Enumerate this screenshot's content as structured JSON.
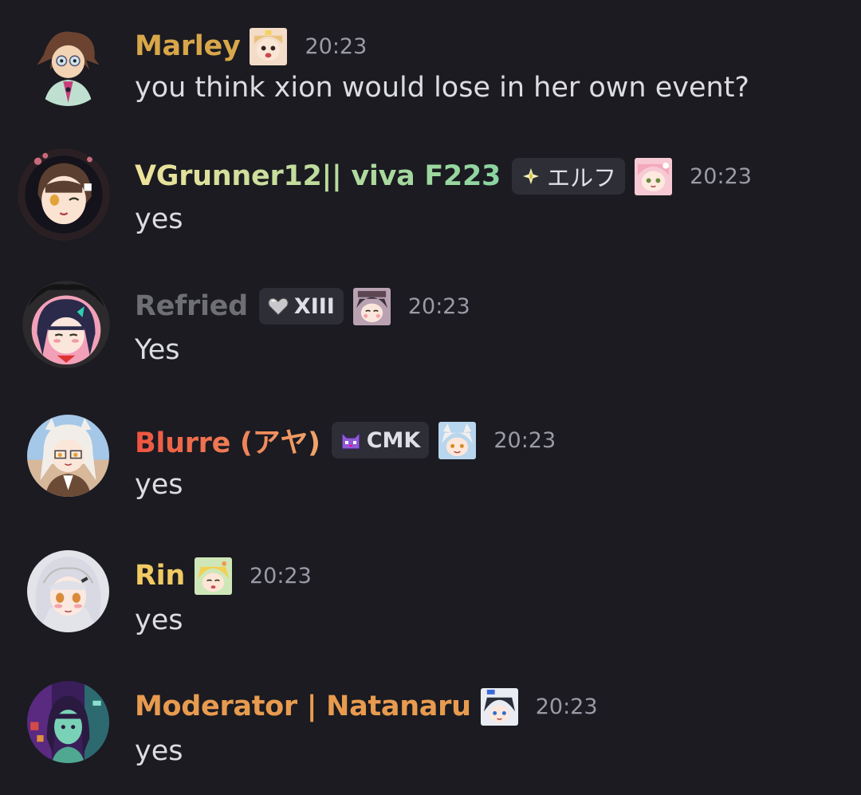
{
  "messages": [
    {
      "author": "Marley",
      "author_color": "#d8a74a",
      "time": "20:23",
      "text": "you think xion would lose in her own event?"
    },
    {
      "author": "VGrunner12|| viva F223",
      "author_gradient": [
        "#efe39a",
        "#8ad4a0"
      ],
      "role_tag": "エルフ",
      "role_icon": "four-point-star-icon",
      "time": "20:23",
      "text": "yes"
    },
    {
      "author": "Refried",
      "author_color": "#6e6f74",
      "role_tag": "XIII",
      "role_icon": "gray-heart-icon",
      "time": "20:23",
      "text": "Yes"
    },
    {
      "author": "Blurre (アヤ)",
      "author_gradient": [
        "#ee5340",
        "#f0a56a"
      ],
      "role_tag": "CMK",
      "role_icon": "purple-cat-icon",
      "time": "20:23",
      "text": "yes"
    },
    {
      "author": "Rin",
      "author_color": "#f0ca62",
      "time": "20:23",
      "text": "yes"
    },
    {
      "author": "Moderator | Natanaru",
      "author_color": "#e89b4f",
      "time": "20:23",
      "text": "yes"
    }
  ],
  "colors": {
    "background": "#1b1b21",
    "message_text": "#dcdde3",
    "timestamp": "#9a9ba6",
    "role_tag_bg": "#2d2e36"
  }
}
